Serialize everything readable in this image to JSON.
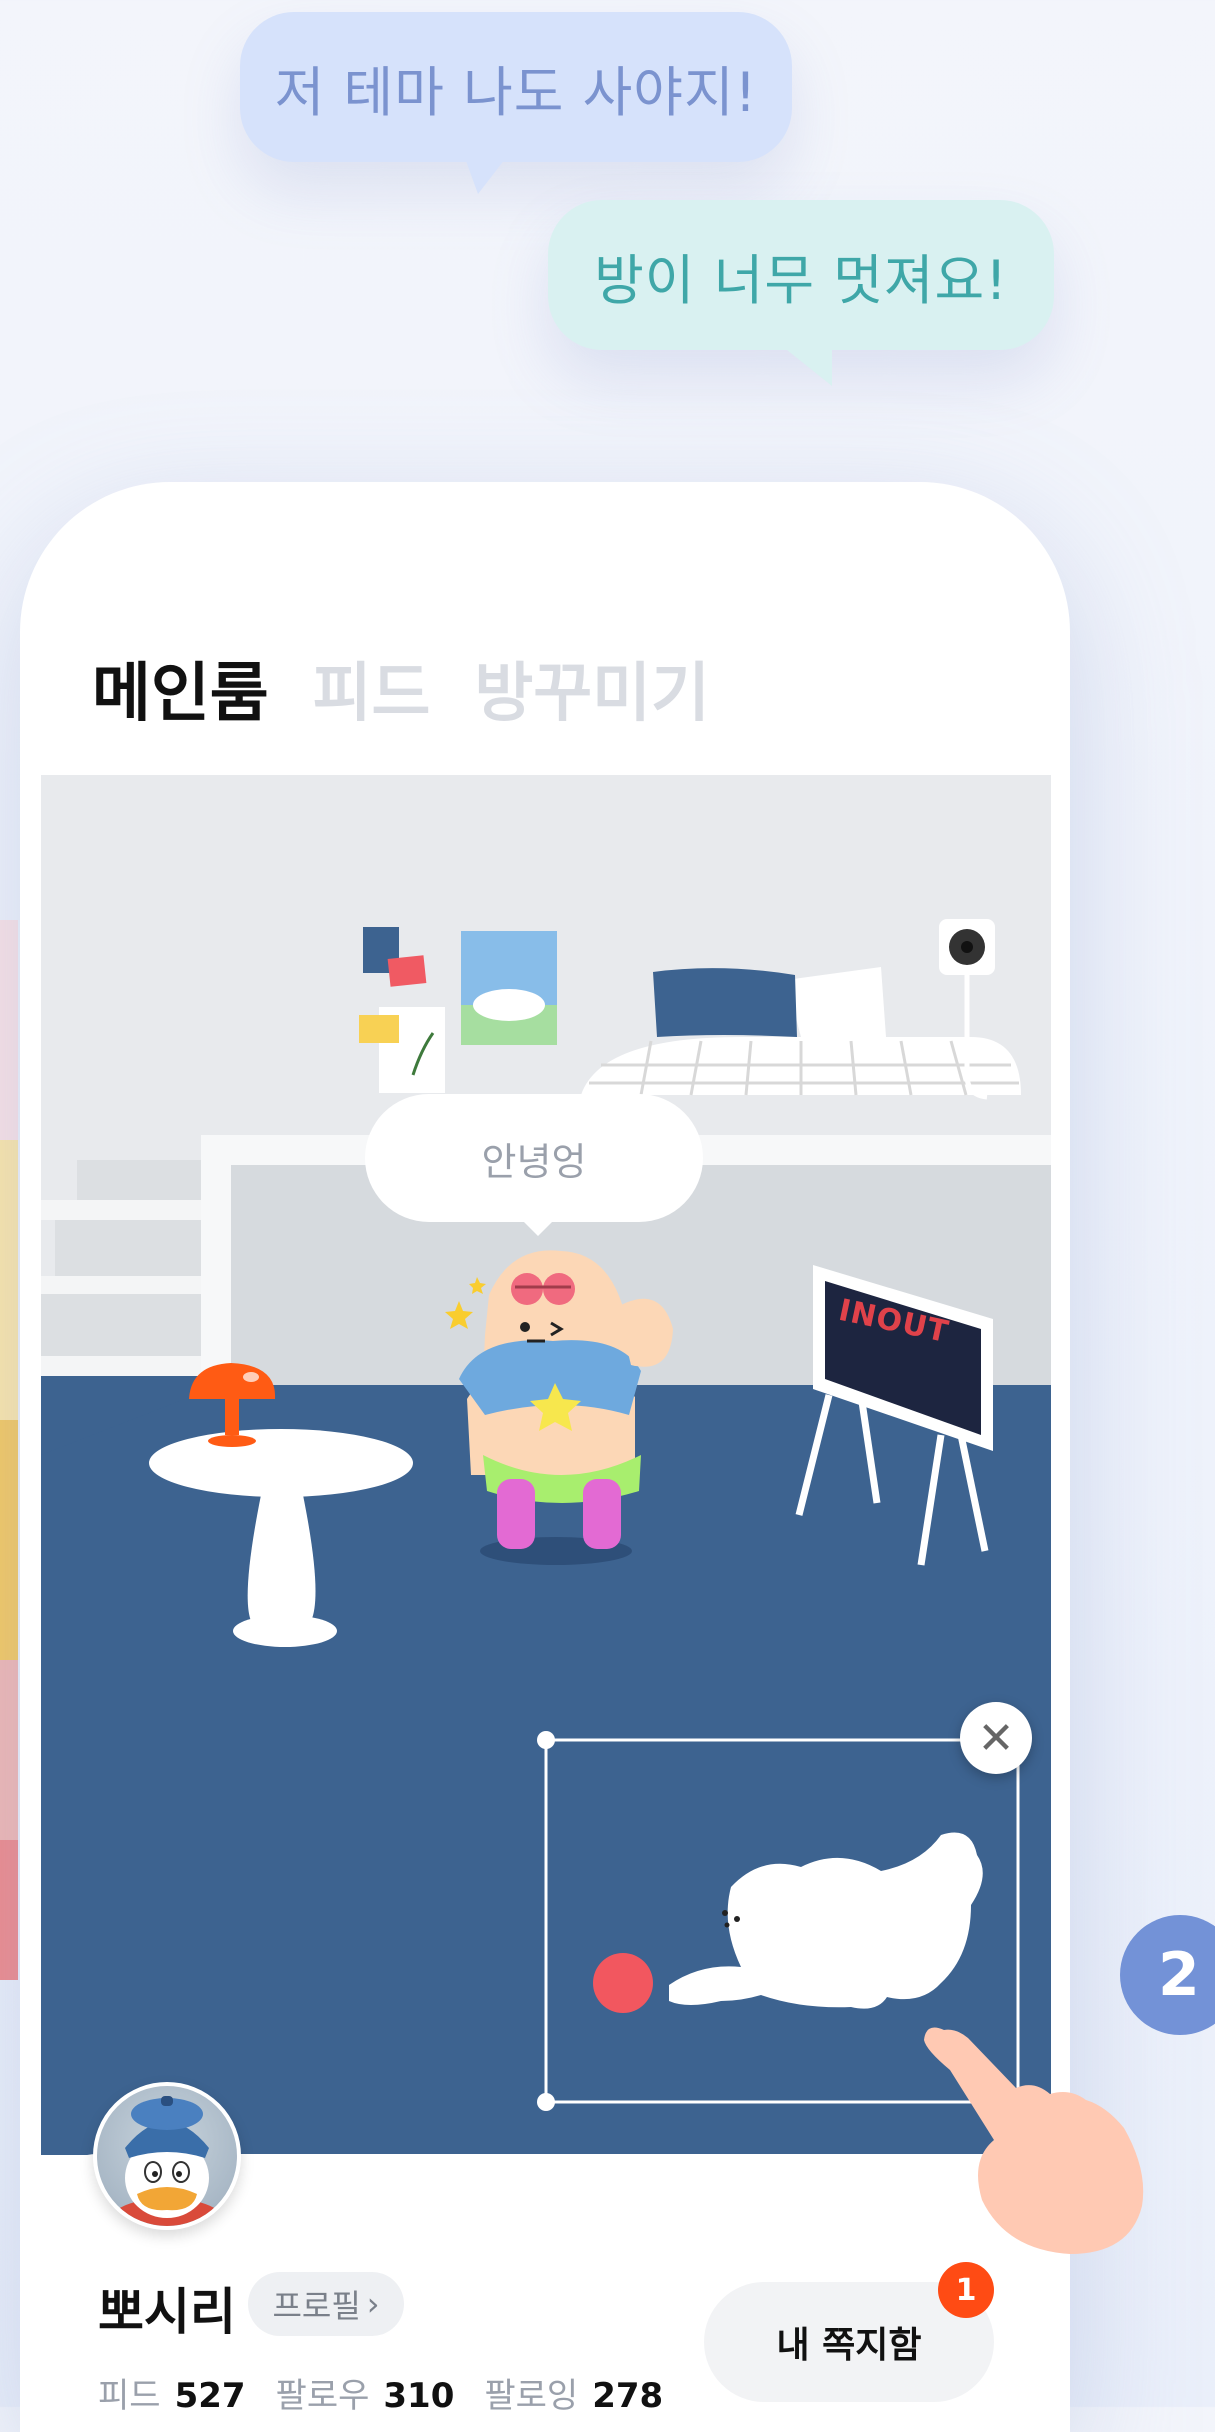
{
  "chat_bubbles": [
    {
      "text": "저 테마 나도 사야지!"
    },
    {
      "text": "방이 너무 멋져요!"
    }
  ],
  "tabs": [
    {
      "label": "메인룸",
      "active": true
    },
    {
      "label": "피드",
      "active": false
    },
    {
      "label": "방꾸미기",
      "active": false
    }
  ],
  "room": {
    "character_speech": "안녕엉",
    "tv_label": "INOUT"
  },
  "profile": {
    "name": "뽀시리",
    "profile_button": "프로필",
    "stats": [
      {
        "label": "피드",
        "value": "527"
      },
      {
        "label": "팔로우",
        "value": "310"
      },
      {
        "label": "팔로잉",
        "value": "278"
      }
    ]
  },
  "inbox": {
    "label": "내 쪽지함",
    "badge": "1"
  },
  "step_indicator": "2",
  "colors": {
    "floor": "#3d6390",
    "wall": "#e8eaed",
    "accent_orange": "#ff4b14",
    "step_blue": "#7392d7"
  },
  "icons": [
    "close-icon",
    "chevron-right-icon",
    "pointing-hand-icon",
    "avatar-duck-icon"
  ]
}
